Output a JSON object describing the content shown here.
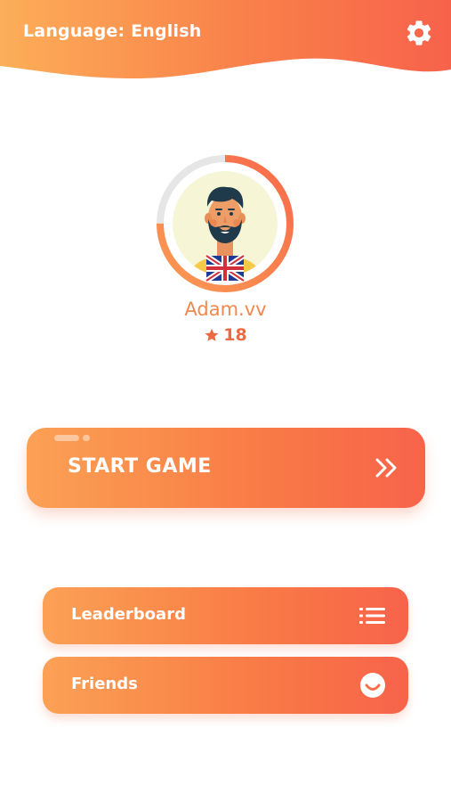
{
  "header": {
    "language_label": "Language: English"
  },
  "profile": {
    "username": "Adam.vv",
    "score": "18",
    "progress_fraction": 0.75,
    "flag": "uk-flag"
  },
  "buttons": {
    "start_game": "START GAME",
    "leaderboard": "Leaderboard",
    "friends": "Friends"
  },
  "icons": {
    "settings": "gear-icon",
    "score": "star-icon",
    "start": "double-chevron-right-icon",
    "leaderboard": "list-icon",
    "friends": "smiley-icon"
  },
  "colors": {
    "accent_light": "#fba154",
    "accent_dark": "#f7634a",
    "username": "#f2884d"
  }
}
